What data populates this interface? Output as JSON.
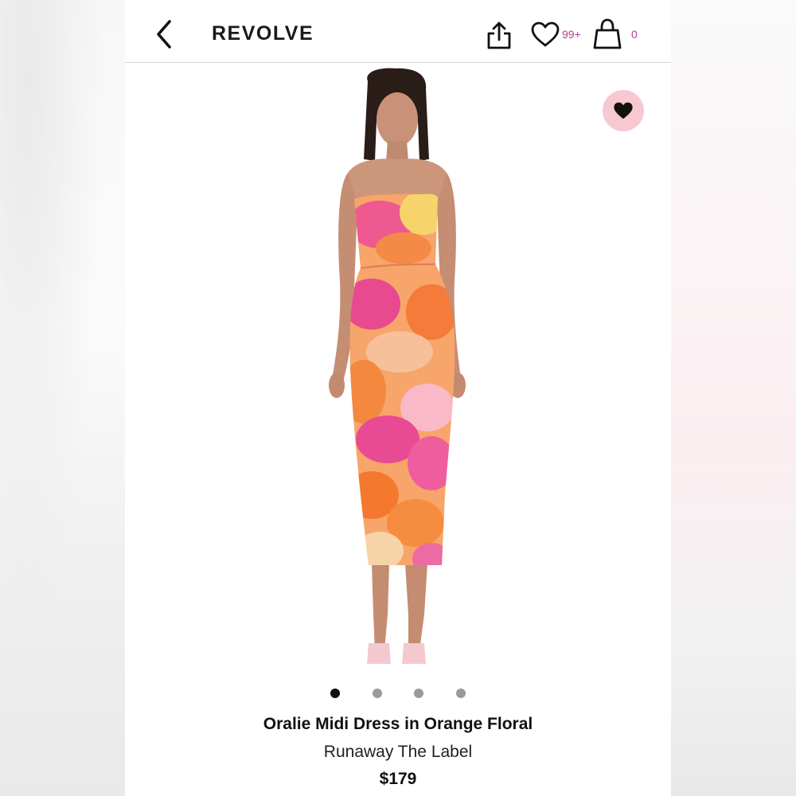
{
  "header": {
    "logo": "REVOLVE",
    "wishlist_count": "99+",
    "bag_count": "0",
    "icons": [
      "back-chevron-icon",
      "share-icon",
      "heart-outline-icon",
      "shopping-bag-icon"
    ]
  },
  "product": {
    "title": "Oralie Midi Dress in Orange Floral",
    "brand": "Runaway The Label",
    "price": "$179",
    "favorite_icon": "heart-filled-icon",
    "image_pager": {
      "total": 4,
      "active_index": 0
    }
  },
  "colors": {
    "accent": "#c0389a",
    "favorite_bg": "#f8c8d0",
    "dot_active": "#111111",
    "dot_inactive": "#9a9a9a"
  }
}
